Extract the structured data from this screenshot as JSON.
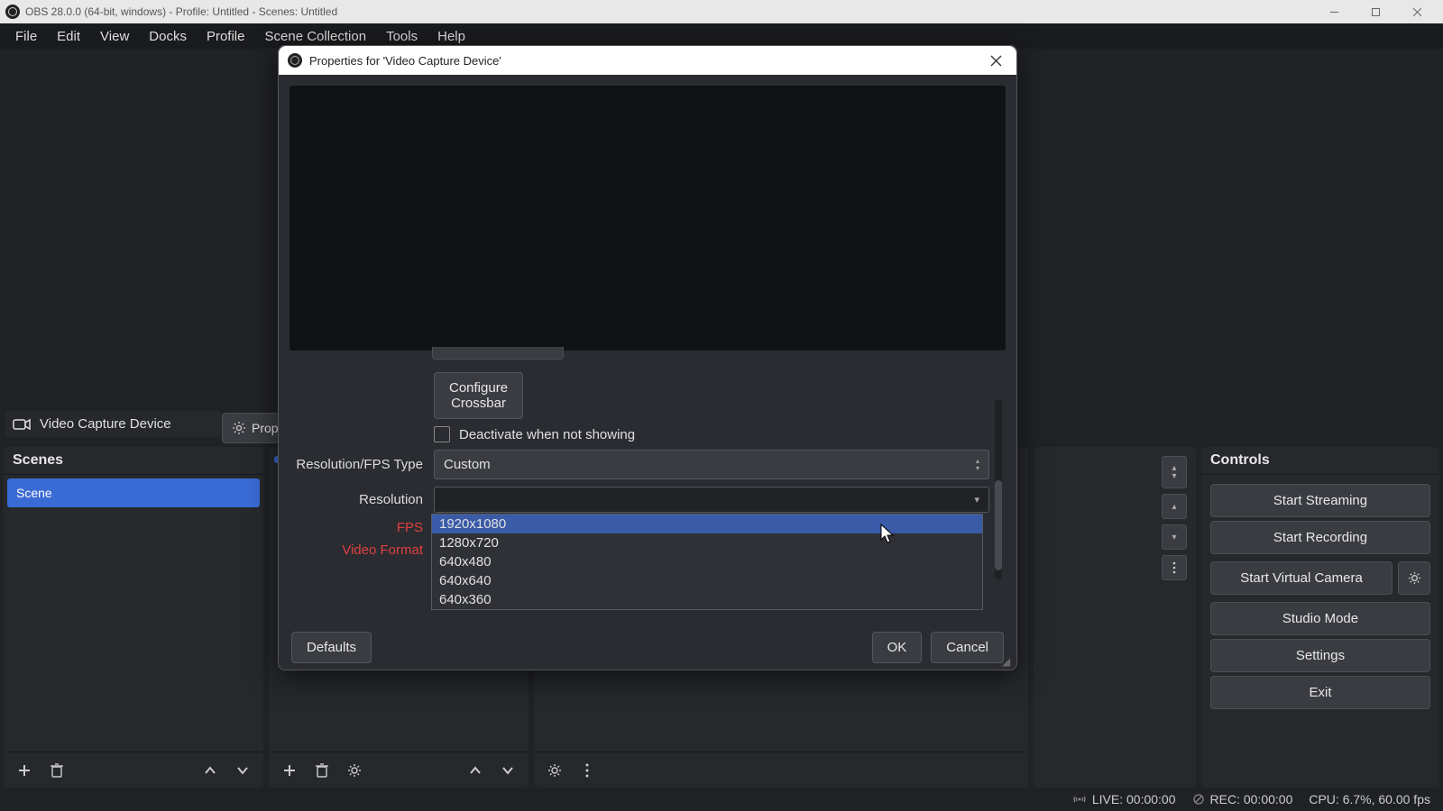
{
  "window": {
    "title": "OBS 28.0.0 (64-bit, windows) - Profile: Untitled - Scenes: Untitled"
  },
  "menubar": [
    "File",
    "Edit",
    "View",
    "Docks",
    "Profile",
    "Scene Collection",
    "Tools",
    "Help"
  ],
  "scenes": {
    "title": "Scenes",
    "items": [
      "Scene"
    ]
  },
  "sources": {
    "items": [
      "Video Capture Device"
    ],
    "prop_btn": "Prop"
  },
  "controls": {
    "title": "Controls",
    "start_streaming": "Start Streaming",
    "start_recording": "Start Recording",
    "start_virtual_camera": "Start Virtual Camera",
    "studio_mode": "Studio Mode",
    "settings": "Settings",
    "exit": "Exit"
  },
  "statusbar": {
    "live": "LIVE: 00:00:00",
    "rec": "REC: 00:00:00",
    "cpu": "CPU: 6.7%, 60.00 fps"
  },
  "dialog": {
    "title": "Properties for 'Video Capture Device'",
    "configure_crossbar": "Configure Crossbar",
    "deactivate_label": "Deactivate when not showing",
    "res_fps_type_label": "Resolution/FPS Type",
    "res_fps_type_value": "Custom",
    "resolution_label": "Resolution",
    "resolution_value": "",
    "fps_label": "FPS",
    "video_format_label": "Video Format",
    "defaults": "Defaults",
    "ok": "OK",
    "cancel": "Cancel",
    "resolution_options": [
      "1920x1080",
      "1280x720",
      "640x480",
      "640x640",
      "640x360"
    ]
  }
}
